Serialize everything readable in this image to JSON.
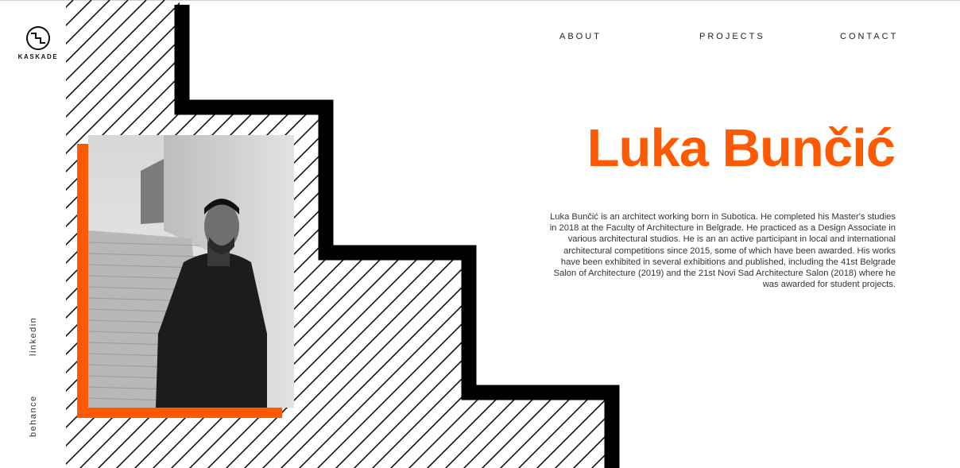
{
  "brand": {
    "name": "KASKADE",
    "logo_icon": "stairs-circle-icon"
  },
  "nav": {
    "about": "ABOUT",
    "projects": "PROJECTS",
    "contact": "CONTACT"
  },
  "hero": {
    "name": "Luka Bunčić",
    "bio": "Luka Bunčić is an architect working born in Subotica. He completed his Master's studies in 2018 at the Faculty of Architecture in Belgrade. He practiced as a Design Associate in various architectural studios. He is an an active participant in local and international architectural competitions since 2015, some of which have been awarded. His works have been exhibited in several exhibitions and published, including the 41st Belgrade Salon of Architecture (2019) and the 21st Novi Sad Architecture Salon (2018) where he was awarded for student projects."
  },
  "social": {
    "linkedin": "linkedin",
    "behance": "behance"
  },
  "colors": {
    "accent": "#ff5a00",
    "stair": "#000000",
    "text": "#333333"
  }
}
